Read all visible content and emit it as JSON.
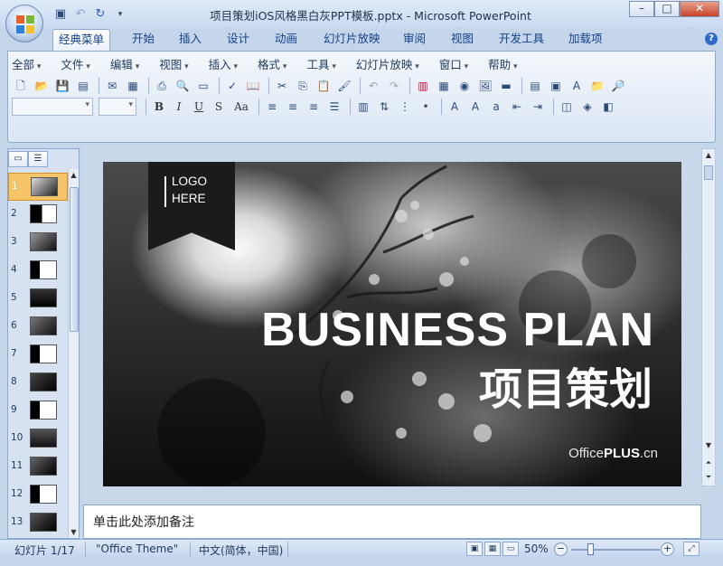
{
  "window": {
    "title": "项目策划iOS风格黑白灰PPT模板.pptx - Microsoft PowerPoint",
    "controls": [
      "–",
      "□",
      "✕"
    ]
  },
  "ribbon_tabs": [
    {
      "label": "经典菜单",
      "active": true
    },
    {
      "label": "开始"
    },
    {
      "label": "插入"
    },
    {
      "label": "设计"
    },
    {
      "label": "动画"
    },
    {
      "label": "幻灯片放映"
    },
    {
      "label": "审阅"
    },
    {
      "label": "视图"
    },
    {
      "label": "开发工具"
    },
    {
      "label": "加载项"
    }
  ],
  "menus": [
    "全部",
    "文件",
    "编辑",
    "视图",
    "插入",
    "格式",
    "工具",
    "幻灯片放映",
    "窗口",
    "帮助"
  ],
  "format_buttons": [
    "B",
    "I",
    "U",
    "S",
    "Aa"
  ],
  "slides": [
    "1",
    "2",
    "3",
    "4",
    "5",
    "6",
    "7",
    "8",
    "9",
    "10",
    "11",
    "12",
    "13"
  ],
  "selected_slide": "1",
  "slide": {
    "logo_line1": "LOGO",
    "logo_line2": "HERE",
    "headline": "BUSINESS PLAN",
    "subhead": "项目策划",
    "brand_prefix": "Office",
    "brand_bold": "PLUS",
    "brand_suffix": ".cn"
  },
  "notes_placeholder": "单击此处添加备注",
  "status": {
    "slide_indicator": "幻灯片 1/17",
    "theme": "\"Office Theme\"",
    "language": "中文(简体，中国)",
    "zoom": "50%"
  }
}
